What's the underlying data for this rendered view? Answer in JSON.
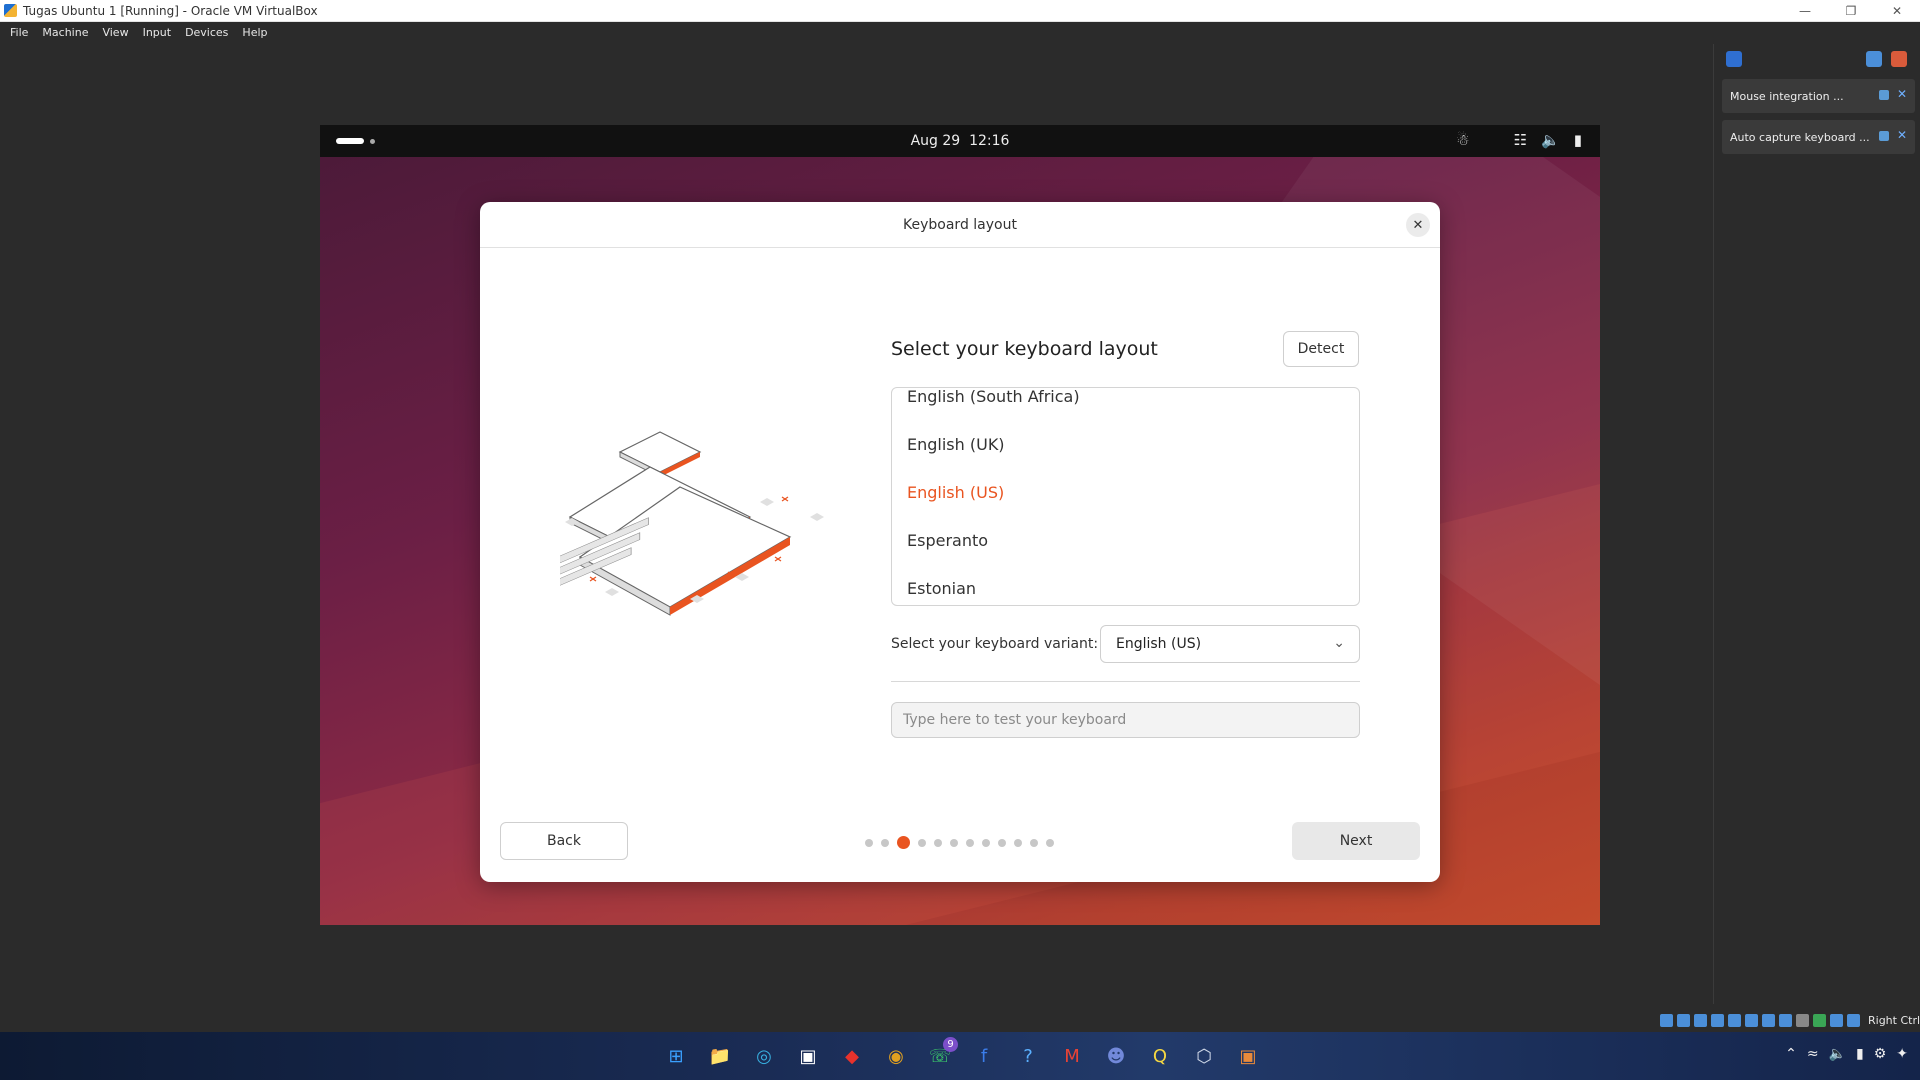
{
  "window": {
    "title": "Tugas Ubuntu 1 [Running] - Oracle VM VirtualBox",
    "controls": [
      "—",
      "❐",
      "✕"
    ]
  },
  "menubar": [
    "File",
    "Machine",
    "View",
    "Input",
    "Devices",
    "Help"
  ],
  "ubuntu_topbar": {
    "date": "Aug 29",
    "time": "12:16"
  },
  "dialog": {
    "title": "Keyboard layout",
    "heading": "Select your keyboard layout",
    "detect_label": "Detect",
    "layouts": [
      "English (South Africa)",
      "English (UK)",
      "English (US)",
      "Esperanto",
      "Estonian"
    ],
    "selected_layout": "English (US)",
    "variant_label": "Select your keyboard variant:",
    "variant_value": "English (US)",
    "test_placeholder": "Type here to test your keyboard",
    "back_label": "Back",
    "next_label": "Next",
    "progress_total": 12,
    "progress_current": 3,
    "accent_color": "#e95420"
  },
  "notifications": [
    {
      "text": "Mouse integration ..."
    },
    {
      "text": "Auto capture keyboard ..."
    }
  ],
  "statusbar": {
    "host_key": "Right Ctrl"
  },
  "taskbar": {
    "whatsapp_badge": "9",
    "apps": [
      "windows-start-icon",
      "file-explorer-icon",
      "edge-icon",
      "store-icon",
      "app-red-icon",
      "chrome-icon",
      "whatsapp-icon",
      "facebook-icon",
      "help-icon",
      "gmail-icon",
      "discord-icon",
      "app-yellow-icon",
      "virtualbox-icon",
      "app-ubuntu-icon"
    ]
  }
}
